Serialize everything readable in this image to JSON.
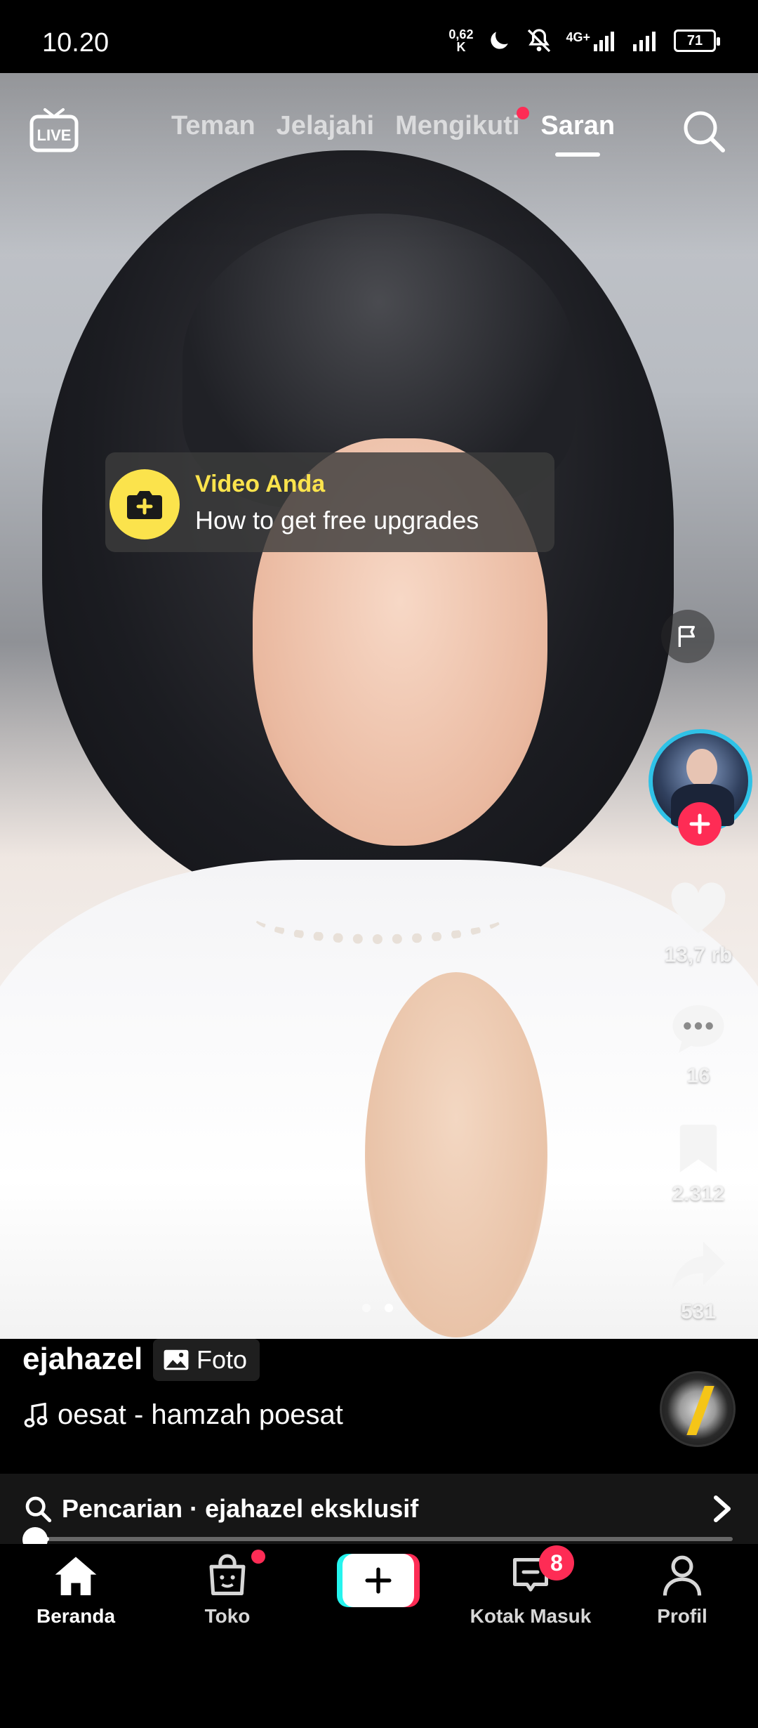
{
  "status_bar": {
    "time": "10.20",
    "speed": "0,62\nK",
    "network": "4G+",
    "battery": "71"
  },
  "top_nav": {
    "tabs": [
      {
        "label": "Teman",
        "active": false
      },
      {
        "label": "Jelajahi",
        "active": false
      },
      {
        "label": "Mengikuti",
        "active": false,
        "dot": true
      },
      {
        "label": "Saran",
        "active": true
      }
    ]
  },
  "toast": {
    "title": "Video Anda",
    "text": "How to get free upgrades"
  },
  "rail": {
    "likes": "13,7 rb",
    "comments": "16",
    "saves": "2.312",
    "shares": "531"
  },
  "carousel": {
    "pages": 2,
    "current": 2
  },
  "caption": {
    "author": "ejahazel",
    "badge": "Foto",
    "music": "oesat - hamzah poesat"
  },
  "search_bar": {
    "text": "Pencarian · ejahazel eksklusif"
  },
  "progress": {
    "fraction": 0.02
  },
  "bottom_nav": {
    "home": "Beranda",
    "shop": "Toko",
    "inbox": "Kotak Masuk",
    "inbox_badge": "8",
    "profile": "Profil"
  },
  "colors": {
    "accent": "#fe2c55",
    "cyan": "#25f4ee",
    "toast_yellow": "#fbe34c",
    "ring": "#2fc2e7"
  }
}
